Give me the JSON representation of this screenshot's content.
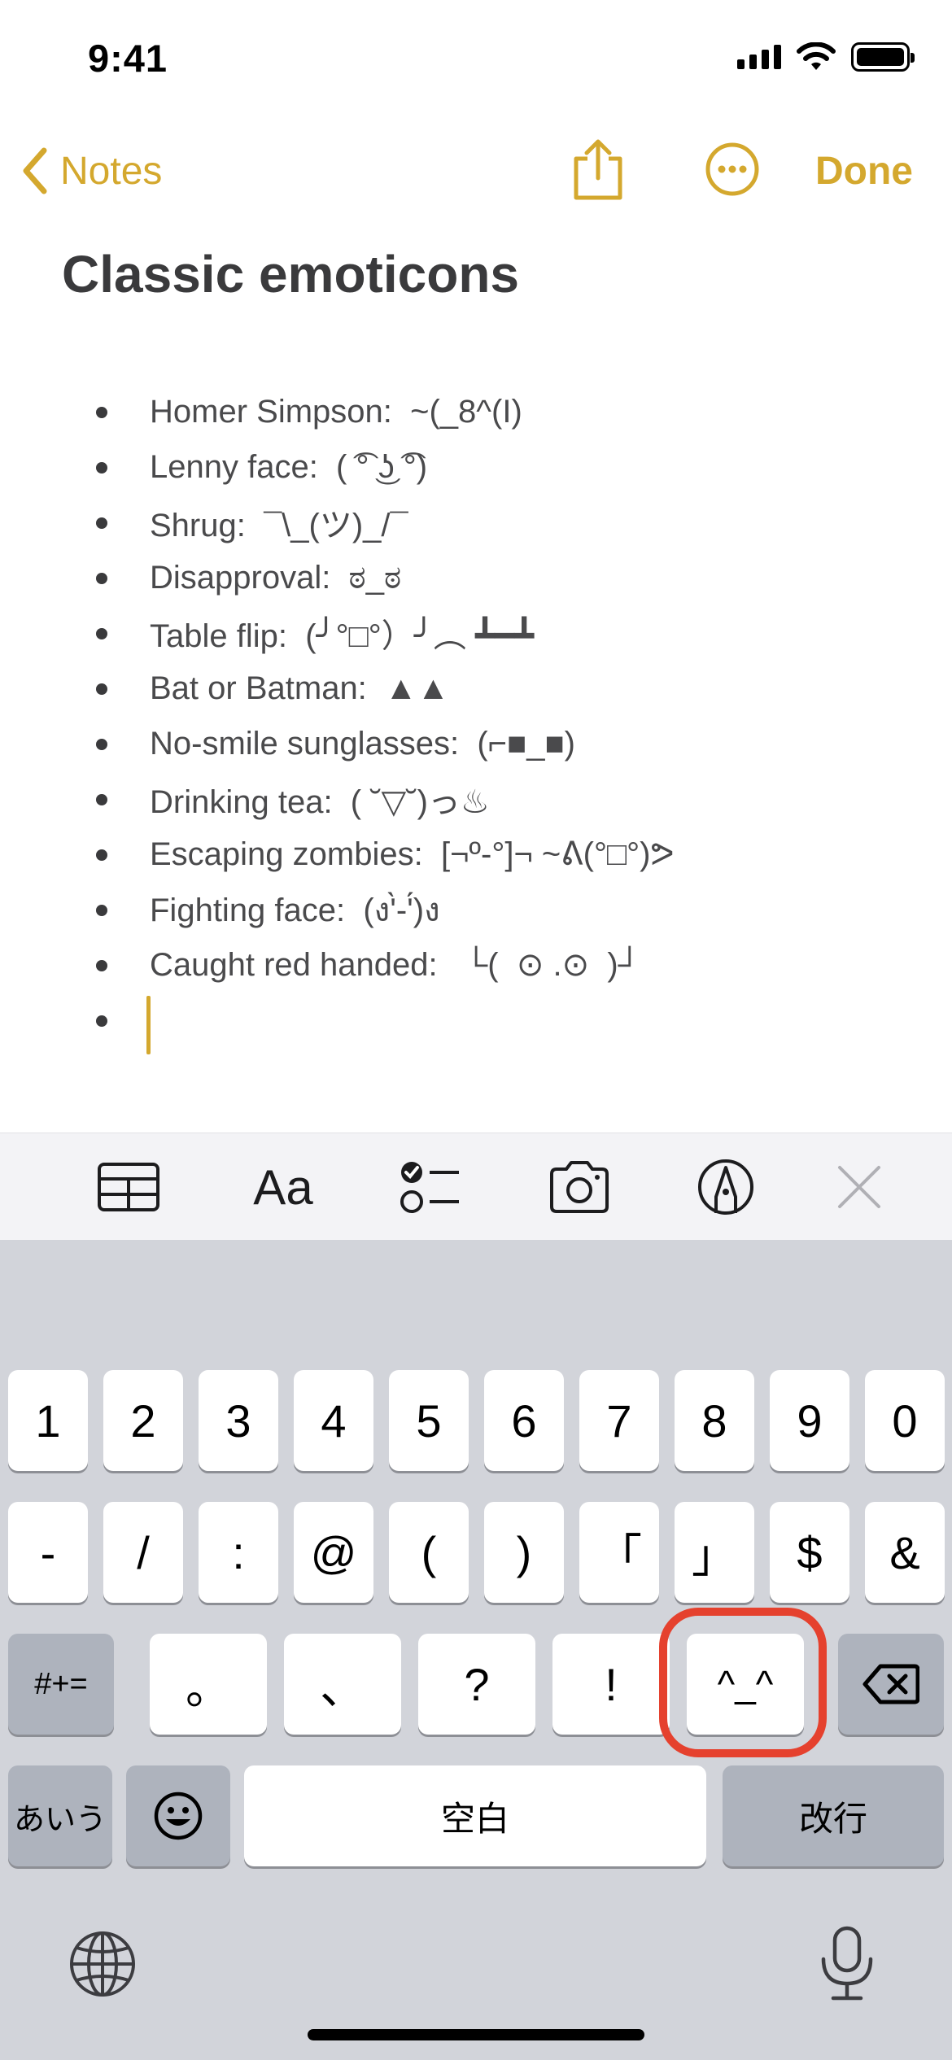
{
  "status_bar": {
    "time": "9:41",
    "icons": [
      "signal-icon",
      "wifi-icon",
      "battery-icon"
    ]
  },
  "nav": {
    "back_label": "Notes",
    "done_label": "Done",
    "icons": [
      "chevron-left-icon",
      "share-icon",
      "more-icon"
    ],
    "accent_color": "#d4a82e"
  },
  "note": {
    "title": "Classic emoticons",
    "items": [
      "Homer Simpson:  ~(_8^(I)",
      "Lenny face:  ( ͡° ͜ʖ ͡°)",
      "Shrug:  ¯\\_(ツ)_/¯",
      "Disapproval:  ಠ_ಠ",
      "Table flip:  (╯°□°）╯︵ ┻━┻",
      "Bat or Batman:  ▲▲",
      "No-smile sunglasses:  (⌐■_■)",
      "Drinking tea:  ( ˘▽˘)っ♨",
      "Escaping zombies:  [¬º-°]¬ ~ᕕ(°□°)ᕗ",
      "Fighting face:  (ง'̀-'́)ง",
      "Caught red handed:   └(  ⊙ .⊙  )┘"
    ]
  },
  "format_toolbar": {
    "items": [
      "table-icon",
      "text-format-icon",
      "checklist-icon",
      "camera-icon",
      "markup-icon",
      "close-icon"
    ],
    "text_format_label": "Aa"
  },
  "keyboard": {
    "row1": [
      "1",
      "2",
      "3",
      "4",
      "5",
      "6",
      "7",
      "8",
      "9",
      "0"
    ],
    "row2": [
      "-",
      "/",
      ":",
      "@",
      "(",
      ")",
      "「",
      "」",
      "$",
      "&"
    ],
    "row3": {
      "shift_label": "#+=",
      "keys": [
        "。",
        "、",
        "?",
        "!",
        "^_^"
      ],
      "delete_icon": "delete-icon"
    },
    "row4": {
      "mode_label": "あいう",
      "emoji_icon": "emoji-icon",
      "space_label": "空白",
      "return_label": "改行"
    },
    "bottom_icons": [
      "globe-icon",
      "microphone-icon"
    ],
    "highlight_color": "#e5412e"
  }
}
